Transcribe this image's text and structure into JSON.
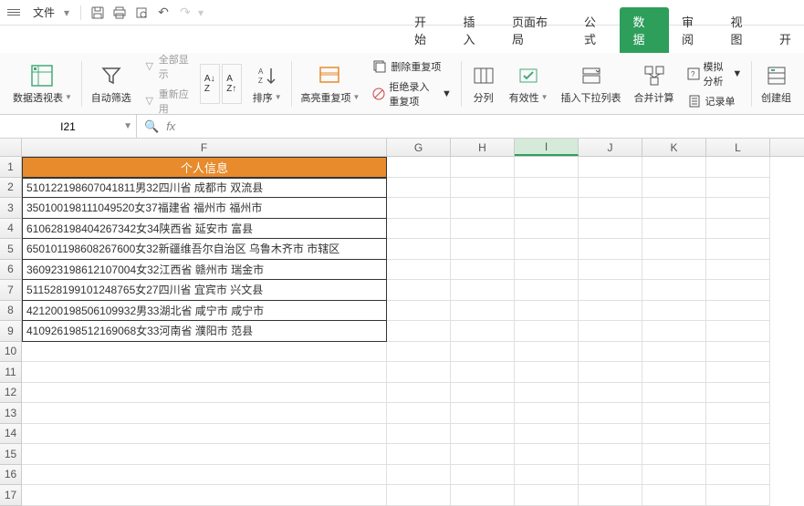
{
  "titlebar": {
    "file": "文件"
  },
  "tabs": {
    "t0": "开始",
    "t1": "插入",
    "t2": "页面布局",
    "t3": "公式",
    "t4": "数据",
    "t5": "审阅",
    "t6": "视图",
    "t7": "开"
  },
  "ribbon": {
    "pivot": "数据透视表",
    "autofilter": "自动筛选",
    "showall": "全部显示",
    "reapply": "重新应用",
    "sort": "排序",
    "highlight": "高亮重复项",
    "dedup": "删除重复项",
    "reject": "拒绝录入重复项",
    "split": "分列",
    "validity": "有效性",
    "insdd": "插入下拉列表",
    "consolidate": "合并计算",
    "whatif": "模拟分析",
    "form": "记录单",
    "group": "创建组"
  },
  "namebox": {
    "value": "I21"
  },
  "cols": {
    "F": "F",
    "G": "G",
    "H": "H",
    "I": "I",
    "J": "J",
    "K": "K",
    "L": "L"
  },
  "colw": {
    "F": 400,
    "other": 70
  },
  "data": {
    "header": "个人信息",
    "r1": "510122198607041811男32四川省  成都市  双流县",
    "r2": "350100198111049520女37福建省  福州市  福州市",
    "r3": "610628198404267342女34陕西省  延安市  富县",
    "r4": "650101198608267600女32新疆维吾尔自治区  乌鲁木齐市  市辖区",
    "r5": "360923198612107004女32江西省  赣州市  瑞金市",
    "r6": "511528199101248765女27四川省  宜宾市  兴文县",
    "r7": "421200198506109932男33湖北省  咸宁市  咸宁市",
    "r8": "410926198512169068女33河南省  濮阳市  范县"
  }
}
